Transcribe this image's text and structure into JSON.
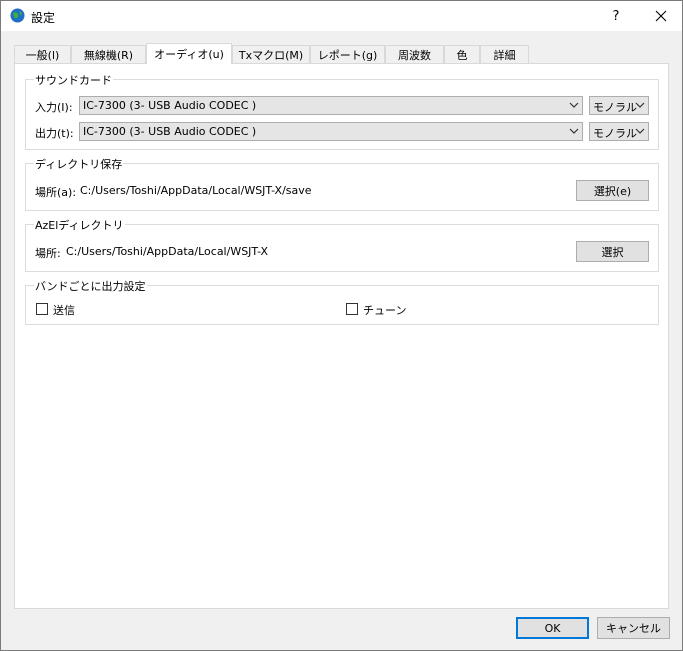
{
  "window": {
    "title": "設定",
    "help_label": "?"
  },
  "tabs": [
    {
      "label": "一般(l)"
    },
    {
      "label": "無線機(R)"
    },
    {
      "label": "オーディオ(u)"
    },
    {
      "label": "Txマクロ(M)"
    },
    {
      "label": "レポート(g)"
    },
    {
      "label": "周波数"
    },
    {
      "label": "色"
    },
    {
      "label": "詳細"
    }
  ],
  "active_tab": "オーディオ(u)",
  "soundcard": {
    "title": "サウンドカード",
    "input_label": "入力(I):",
    "input_device": "IC-7300 (3- USB Audio CODEC )",
    "input_channel": "モノラル",
    "output_label": "出力(t):",
    "output_device": "IC-7300 (3- USB Audio CODEC )",
    "output_channel": "モノラル"
  },
  "save_dir": {
    "title": "ディレクトリ保存",
    "location_label": "場所(a):",
    "path": "C:/Users/Toshi/AppData/Local/WSJT-X/save",
    "select_label": "選択(e)"
  },
  "azel_dir": {
    "title": "AzElディレクトリ",
    "location_label": "場所:",
    "path": "C:/Users/Toshi/AppData/Local/WSJT-X",
    "select_label": "選択"
  },
  "band_output": {
    "title": "バンドごとに出力設定",
    "transmit_label": "送信",
    "transmit_checked": false,
    "tune_label": "チューン",
    "tune_checked": false
  },
  "footer": {
    "ok_label": "OK",
    "cancel_label": "キャンセル"
  }
}
